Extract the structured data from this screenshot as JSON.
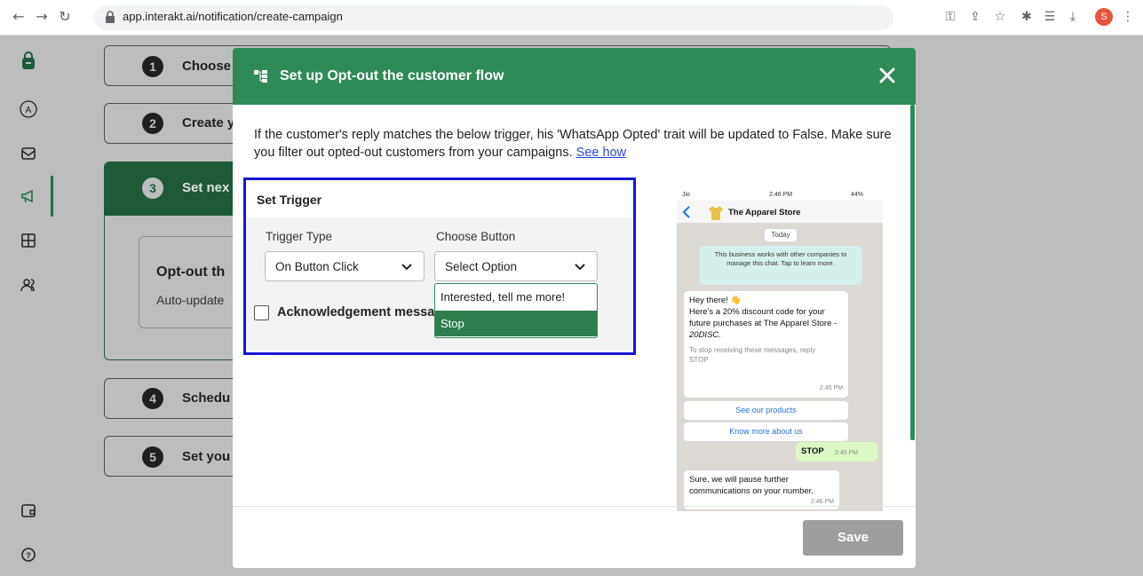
{
  "browser": {
    "url": "app.interakt.ai/notification/create-campaign",
    "profile_initial": "S"
  },
  "steps": [
    {
      "number": "1",
      "label": "Choose"
    },
    {
      "number": "2",
      "label": "Create y"
    },
    {
      "number": "3",
      "label": "Set nex"
    },
    {
      "number": "4",
      "label": "Schedu"
    },
    {
      "number": "5",
      "label": "Set you"
    }
  ],
  "background_card": {
    "title": "Opt-out th",
    "subtitle": "Auto-update"
  },
  "modal": {
    "title": "Set up Opt-out the customer flow",
    "description": "If the customer's reply matches the below trigger, his 'WhatsApp Opted' trait will be updated to False. Make sure you filter out opted-out customers from your campaigns.",
    "see_how_link": "See how",
    "trigger": {
      "title": "Set Trigger",
      "trigger_type_label": "Trigger Type",
      "trigger_type_value": "On Button Click",
      "choose_button_label": "Choose Button",
      "choose_button_value": "Select Option",
      "options": [
        "Interested, tell me more!",
        "Stop"
      ],
      "selected_option": "Stop",
      "acknowledgement_label": "Acknowledgement messag"
    },
    "save_label": "Save"
  },
  "phone": {
    "carrier": "Jio",
    "time": "2:46 PM",
    "battery": "44%",
    "store_name": "The Apparel Store",
    "today": "Today",
    "notice": "This business works with other companies to manage this chat. Tap to learn more.",
    "msg1_line1": "Hey there! 👋",
    "msg1_body": "Here's a 20% discount code for your future purchases at The Apparel Store - ",
    "msg1_code": "20DISC.",
    "msg1_footer": "To stop receiving these messages, reply STOP",
    "msg1_time": "2:45 PM",
    "button1": "See our products",
    "button2": "Know more about us",
    "out_msg": "STOP",
    "out_time": "2:45 PM",
    "msg2": "Sure, we will pause further communications on your number.",
    "msg2_time": "2:46 PM"
  },
  "colors": {
    "header_green": "#2e8b57",
    "dark_green": "#1c5a38",
    "trigger_border": "#1515d6",
    "link": "#2b4bd4"
  }
}
